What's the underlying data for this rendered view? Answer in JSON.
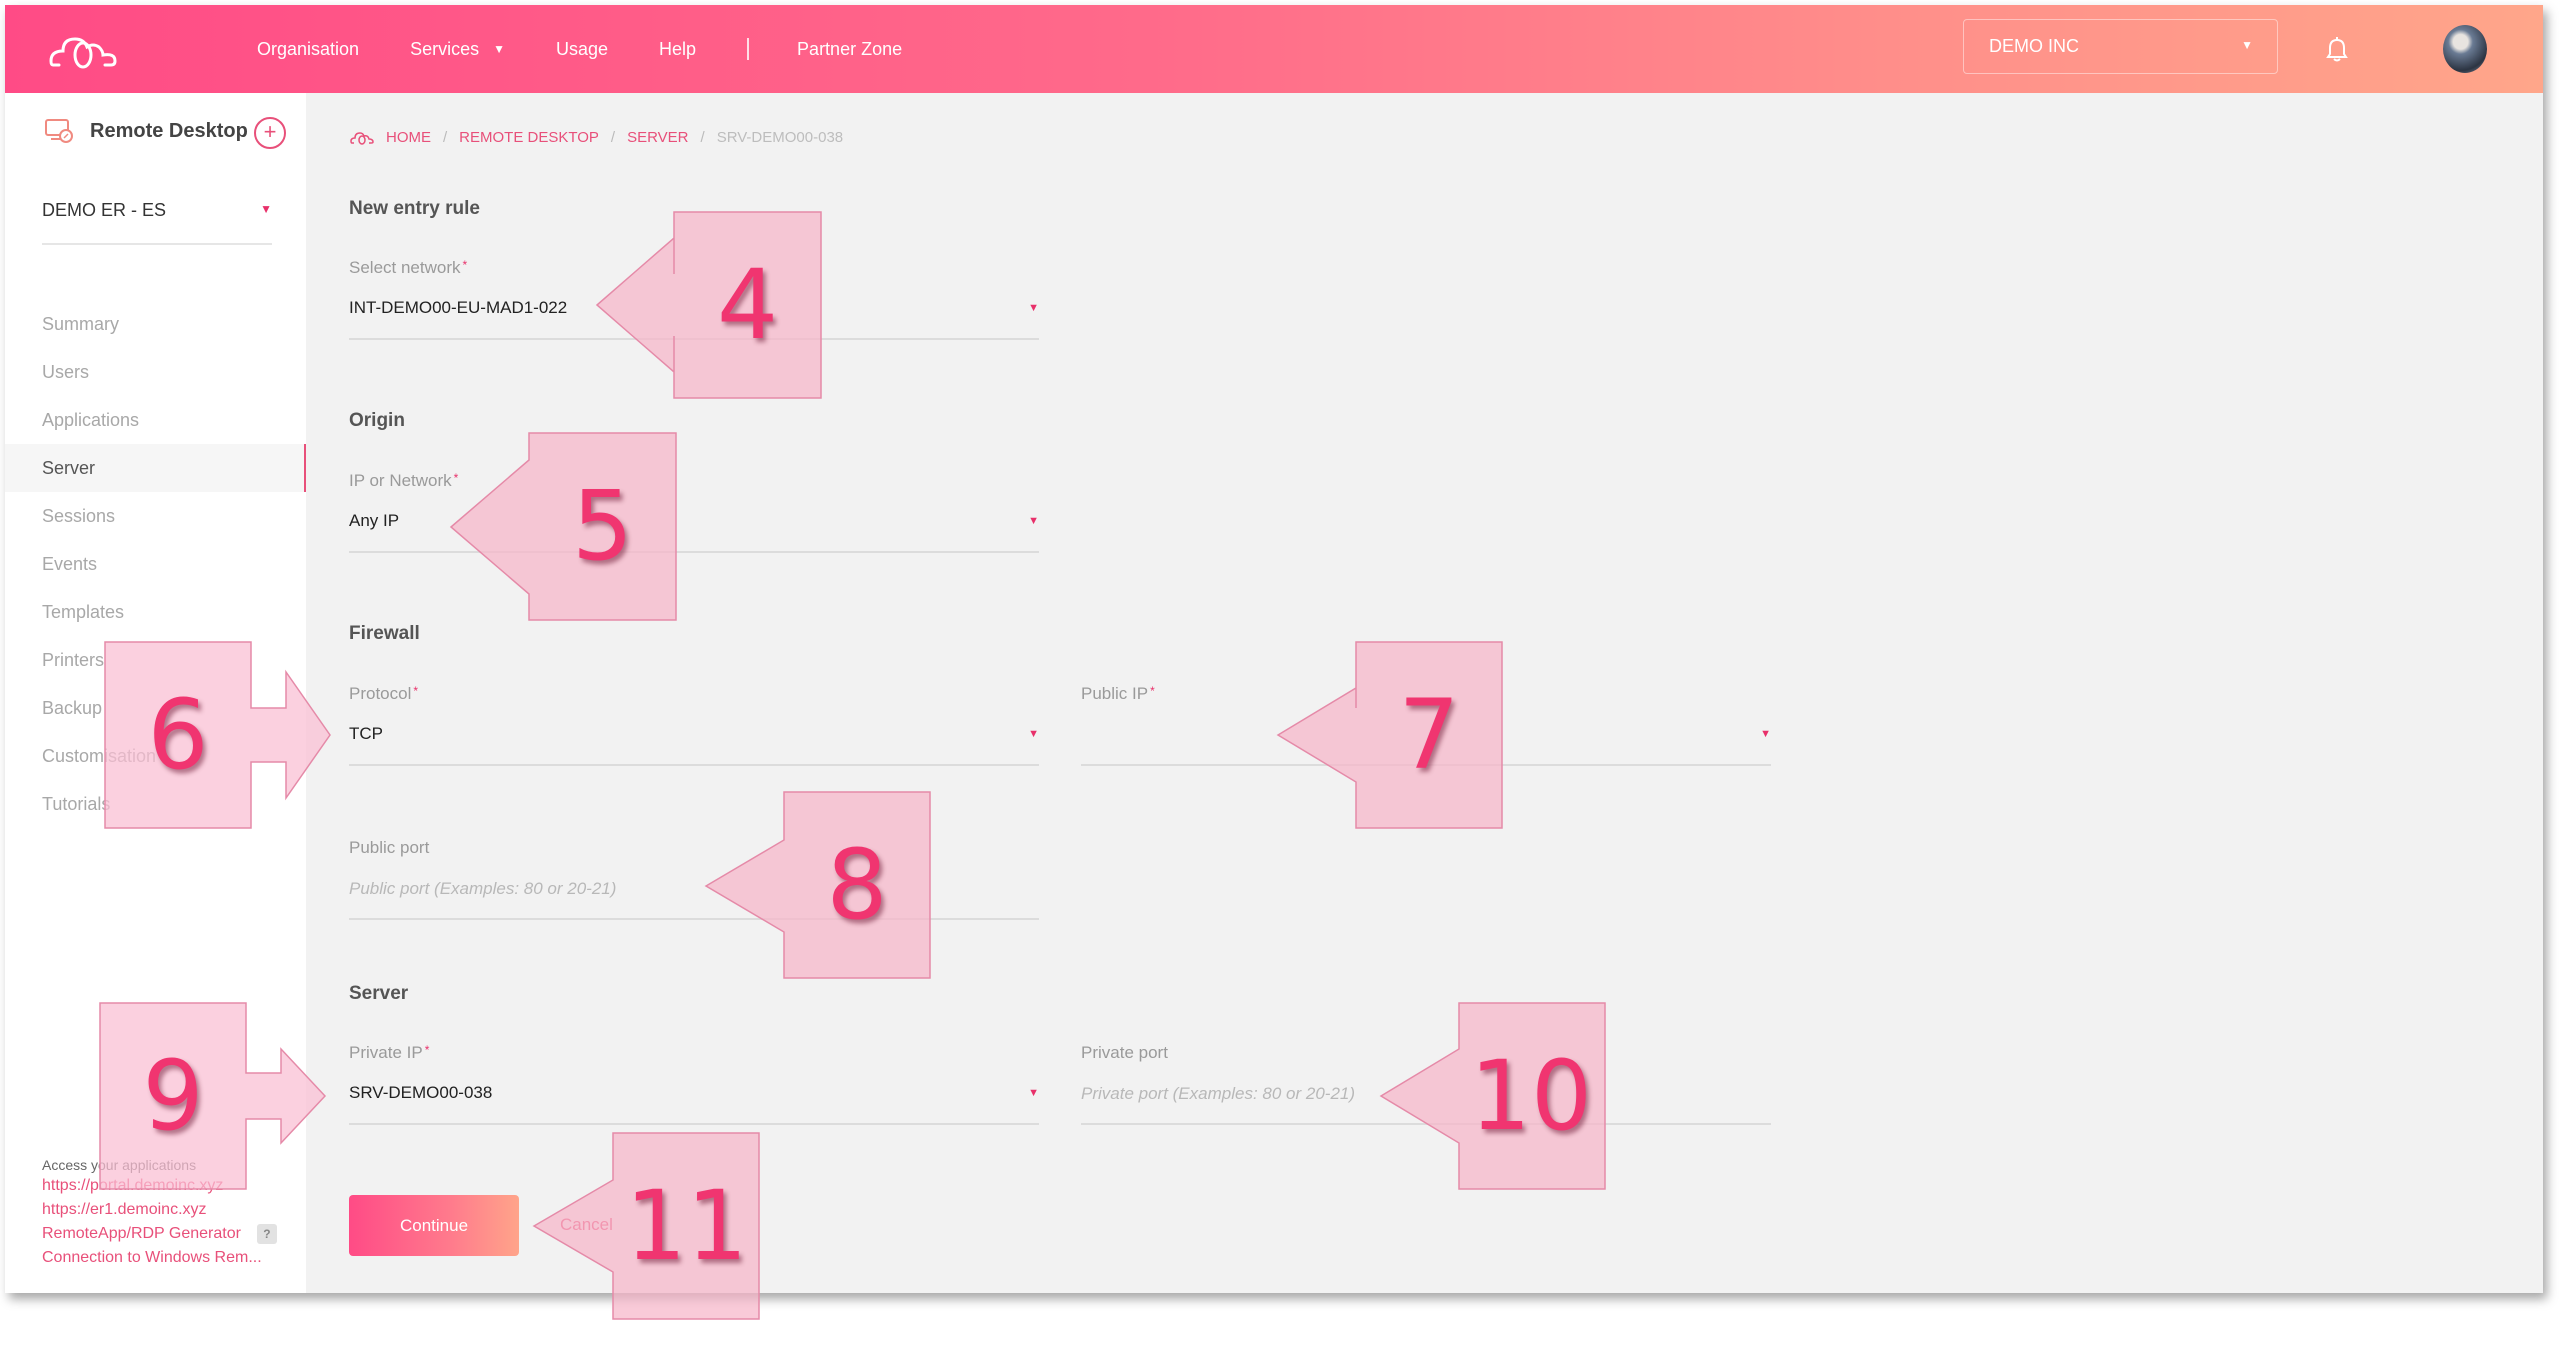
{
  "header": {
    "nav": [
      {
        "label": "Organisation"
      },
      {
        "label": "Services",
        "has_caret": true
      },
      {
        "label": "Usage"
      },
      {
        "label": "Help"
      }
    ],
    "partner_zone": "Partner Zone",
    "org_selector": "DEMO INC",
    "icons": {
      "logo": "cloud-logo-icon",
      "bell": "bell-icon",
      "avatar": "user-avatar"
    }
  },
  "sidebar": {
    "app_title": "Remote Desktop",
    "add_label": "+",
    "org": "DEMO ER - ES",
    "items": [
      {
        "label": "Summary"
      },
      {
        "label": "Users"
      },
      {
        "label": "Applications"
      },
      {
        "label": "Server",
        "active": true
      },
      {
        "label": "Sessions"
      },
      {
        "label": "Events"
      },
      {
        "label": "Templates"
      },
      {
        "label": "Printers"
      },
      {
        "label": "Backup"
      },
      {
        "label": "Customisation"
      },
      {
        "label": "Tutorials"
      }
    ],
    "links_title": "Access your applications",
    "links": [
      "https://portal.demoinc.xyz",
      "https://er1.demoinc.xyz",
      "RemoteApp/RDP Generator",
      "Connection to Windows Rem..."
    ],
    "help_badge": "?"
  },
  "breadcrumb": {
    "items": [
      "HOME",
      "REMOTE DESKTOP",
      "SERVER"
    ],
    "current": "SRV-DEMO00-038",
    "separator": "/"
  },
  "form": {
    "title": "New entry rule",
    "select_network": {
      "label": "Select network",
      "required": "*",
      "value": "INT-DEMO00-EU-MAD1-022"
    },
    "origin_title": "Origin",
    "ip_or_network": {
      "label": "IP or Network",
      "required": "*",
      "value": "Any IP"
    },
    "firewall_title": "Firewall",
    "protocol": {
      "label": "Protocol",
      "required": "*",
      "value": "TCP"
    },
    "public_ip": {
      "label": "Public IP",
      "required": "*",
      "value": ""
    },
    "public_port": {
      "label": "Public port",
      "placeholder": "Public port (Examples: 80 or 20-21)",
      "value": ""
    },
    "server_title": "Server",
    "private_ip": {
      "label": "Private IP",
      "required": "*",
      "value": "SRV-DEMO00-038"
    },
    "private_port": {
      "label": "Private port",
      "placeholder": "Private port (Examples: 80 or 20-21)",
      "value": ""
    },
    "continue_label": "Continue",
    "cancel_label": "Cancel",
    "caret": "▼"
  },
  "callouts": [
    {
      "number": "4",
      "target": "select-network"
    },
    {
      "number": "5",
      "target": "ip-or-network"
    },
    {
      "number": "6",
      "target": "protocol"
    },
    {
      "number": "7",
      "target": "public-ip"
    },
    {
      "number": "8",
      "target": "public-port"
    },
    {
      "number": "9",
      "target": "private-ip"
    },
    {
      "number": "10",
      "target": "private-port"
    },
    {
      "number": "11",
      "target": "cancel"
    }
  ],
  "colors": {
    "accent": "#e8507a",
    "header_start": "#ff4b86",
    "header_end": "#ffa68a",
    "callout_fill": "#f7c6d6",
    "callout_number": "#f03570",
    "background": "#f2f2f2"
  }
}
